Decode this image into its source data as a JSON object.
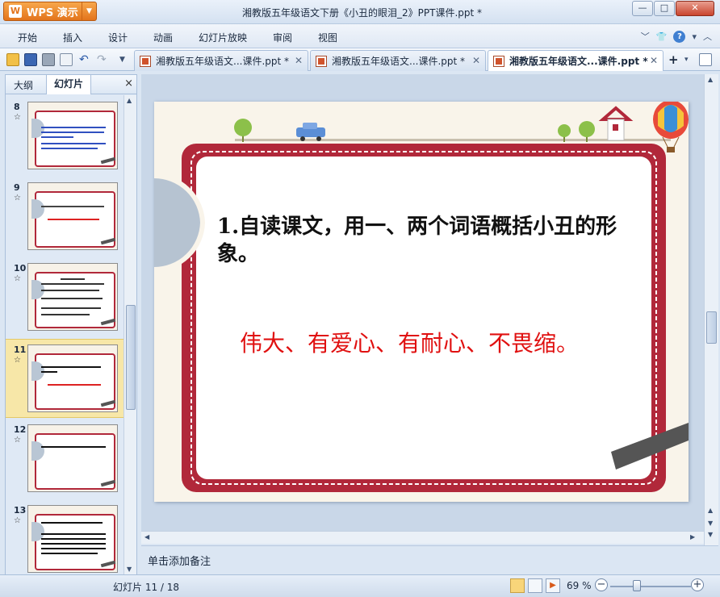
{
  "window": {
    "app_button": "WPS 演示",
    "title": "湘教版五年级语文下册《小丑的眼泪_2》PPT课件.ppt *"
  },
  "menu": {
    "items": [
      "开始",
      "插入",
      "设计",
      "动画",
      "幻灯片放映",
      "审阅",
      "视图"
    ]
  },
  "tabs": [
    {
      "label": "湘教版五年级语文...课件.ppt *"
    },
    {
      "label": "湘教版五年级语文...课件.ppt *"
    },
    {
      "label": "湘教版五年级语文...课件.ppt *"
    }
  ],
  "left_panel": {
    "tab_outline": "大纲",
    "tab_slides": "幻灯片",
    "close": "×",
    "thumbnails": [
      {
        "number": "8"
      },
      {
        "number": "9"
      },
      {
        "number": "10"
      },
      {
        "number": "11"
      },
      {
        "number": "12"
      },
      {
        "number": "13"
      }
    ],
    "selected_thumbnail": "11"
  },
  "slide": {
    "question": "1.自读课文，用一、两个词语概括小丑的形象。",
    "answer": "伟大、有爱心、有耐心、不畏缩。",
    "question_color": "#111111",
    "answer_color": "#e01010",
    "frame_color": "#b1283a"
  },
  "notes": {
    "placeholder": "单击添加备注"
  },
  "status": {
    "slide_count": "幻灯片 11 / 18",
    "zoom": "69 %"
  }
}
